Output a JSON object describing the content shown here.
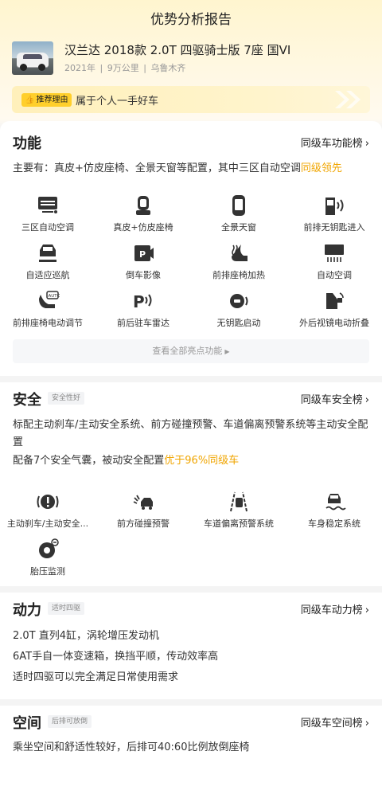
{
  "header": {
    "title": "优势分析报告"
  },
  "car": {
    "name": "汉兰达 2018款 2.0T 四驱骑士版 7座 国VI",
    "year": "2021年",
    "mileage": "9万公里",
    "city": "乌鲁木齐",
    "separator": "|"
  },
  "reason": {
    "tag": "推荐理由",
    "text": "属于个人一手好车"
  },
  "function": {
    "title": "功能",
    "rank_link": "同级车功能榜",
    "desc_main": "主要有：真皮+仿皮座椅、全景天窗等配置，其中三区自动空调",
    "desc_highlight": "同级领先",
    "items": [
      {
        "label": "三区自动空调",
        "icon": "ac-vent-icon"
      },
      {
        "label": "真皮+仿皮座椅",
        "icon": "seat-icon"
      },
      {
        "label": "全景天窗",
        "icon": "sunroof-icon"
      },
      {
        "label": "前排无钥匙进入",
        "icon": "keyless-entry-icon"
      },
      {
        "label": "自适应巡航",
        "icon": "adaptive-cruise-icon"
      },
      {
        "label": "倒车影像",
        "icon": "reverse-camera-icon"
      },
      {
        "label": "前排座椅加热",
        "icon": "seat-heating-icon"
      },
      {
        "label": "自动空调",
        "icon": "auto-ac-icon"
      },
      {
        "label": "前排座椅电动调节",
        "icon": "power-seat-icon"
      },
      {
        "label": "前后驻车雷达",
        "icon": "parking-radar-icon"
      },
      {
        "label": "无钥匙启动",
        "icon": "keyless-start-icon"
      },
      {
        "label": "外后视镜电动折叠",
        "icon": "mirror-fold-icon"
      }
    ],
    "view_all": "查看全部亮点功能"
  },
  "safety": {
    "title": "安全",
    "badge": "安全性好",
    "rank_link": "同级车安全榜",
    "desc1": "标配主动刹车/主动安全系统、前方碰撞预警、车道偏离预警系统等主动安全配置",
    "desc2_main": "配备7个安全气囊，被动安全配置",
    "desc2_highlight": "优于96%同级车",
    "items": [
      {
        "label": "主动刹车/主动安全...",
        "icon": "active-brake-icon"
      },
      {
        "label": "前方碰撞预警",
        "icon": "collision-warning-icon"
      },
      {
        "label": "车道偏离预警系统",
        "icon": "lane-departure-icon"
      },
      {
        "label": "车身稳定系统",
        "icon": "stability-control-icon"
      },
      {
        "label": "胎压监测",
        "icon": "tire-pressure-icon"
      }
    ]
  },
  "power": {
    "title": "动力",
    "badge": "适时四驱",
    "rank_link": "同级车动力榜",
    "lines": [
      "2.0T 直列4缸，涡轮增压发动机",
      "6AT手自一体变速箱，换挡平顺，传动效率高",
      "适时四驱可以完全满足日常使用需求"
    ]
  },
  "space": {
    "title": "空间",
    "badge": "后排可放倒",
    "rank_link": "同级车空间榜",
    "desc": "乘坐空间和舒适性较好，后排可40:60比例放倒座椅"
  }
}
